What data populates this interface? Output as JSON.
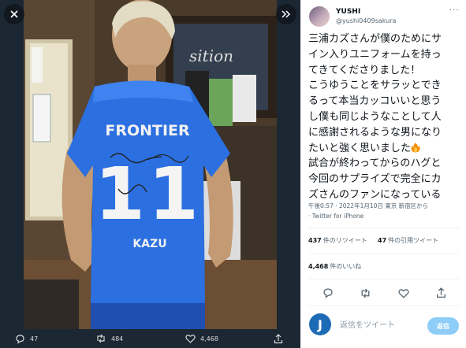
{
  "viewer": {
    "close_icon": "close-icon",
    "expand_icon": "double-chevron-right-icon",
    "jersey": {
      "sponsor": "FRONTIER",
      "number": "11",
      "name": "KAZU"
    },
    "actions": {
      "replies": "47",
      "retweets": "484",
      "likes": "4,468"
    }
  },
  "tweet": {
    "author_name": "YUSHI",
    "author_handle": "@yushi0409sakura",
    "more_label": "···",
    "lines": [
      "三浦カズさんが僕のためにサ",
      "イン入りユニフォームを持っ",
      "てきてくださりました！",
      "こうゆうことをサラッとでき",
      "るって本当カッコいいと思う",
      "し僕も同じようなことして人",
      "に感謝されるような男になり",
      "たいと強く思いました",
      "試合が終わってからのハグと",
      "今回のサプライズで完全にカ",
      "ズさんのファンになっている"
    ],
    "timestamp": "午後0:57 · 2022年1月10日 東京 新宿区から",
    "via": "· Twitter for iPhone",
    "retweets_count": "437",
    "retweets_label": "件のリツイート",
    "quotes_count": "47",
    "quotes_label": "件の引用ツイート",
    "likes_count": "4,468",
    "likes_label": "件のいいね",
    "reply_avatar_letter": "J",
    "reply_placeholder": "返信をツイート",
    "reply_button": "返信"
  },
  "colors": {
    "accent": "#1d9bf0",
    "reply_button": "#8ecdf8",
    "jersey": "#2b6fe0"
  }
}
